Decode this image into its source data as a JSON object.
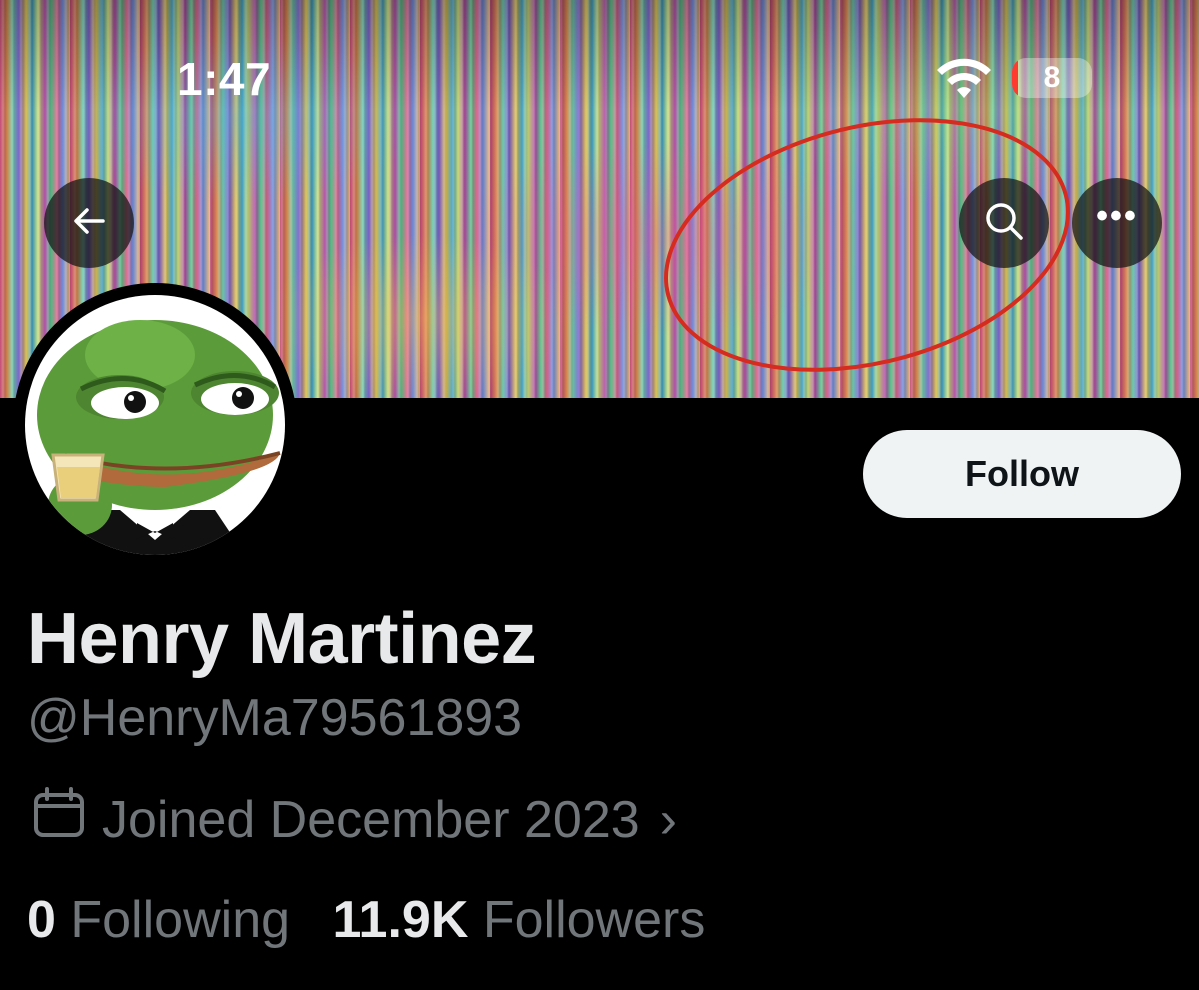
{
  "status_bar": {
    "time": "1:47",
    "battery_level": "8",
    "battery_fraction": 0.08,
    "wifi_icon": "wifi-icon"
  },
  "header": {
    "back_icon": "arrow-left-icon",
    "search_icon": "search-icon",
    "more_icon": "more-horizontal-icon",
    "more_label": "•••"
  },
  "profile": {
    "name": "Henry Martinez",
    "handle": "@HenryMa79561893",
    "joined": "Joined December 2023",
    "joined_icon": "calendar-icon",
    "joined_chevron": "›",
    "following_count": "0",
    "following_label": "Following",
    "followers_count": "11.9K",
    "followers_label": "Followers",
    "follow_button_label": "Follow"
  },
  "colors": {
    "background": "#000000",
    "primary_text": "#e7e9ea",
    "secondary_text": "#71767b",
    "follow_button_bg": "#eff3f4",
    "annotation_red": "#d62b1f",
    "battery_red": "#ff3b30"
  }
}
